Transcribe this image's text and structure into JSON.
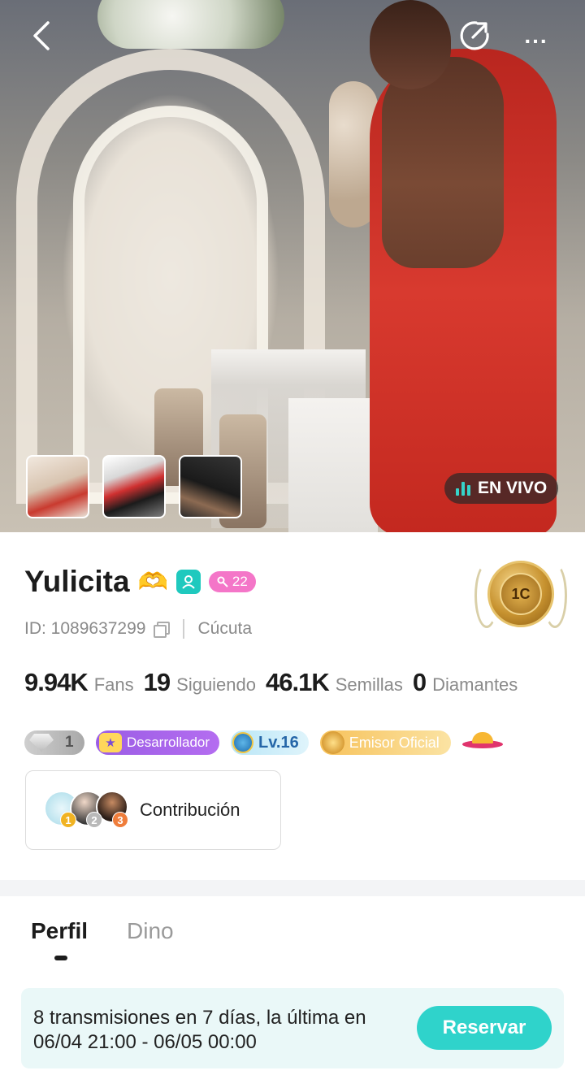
{
  "hero": {
    "live_label": "EN VIVO",
    "thumbnails": [
      "photo-1",
      "photo-2",
      "photo-3"
    ]
  },
  "header": {
    "back_icon": "chevron-left-icon",
    "share_icon": "share-icon",
    "more_label": "..."
  },
  "profile": {
    "name": "Yulicita",
    "name_emoji": "🫶",
    "level_badge": "22",
    "id_text": "ID: 1089637299",
    "city": "Cúcuta",
    "medal_text": "1C"
  },
  "stats": [
    {
      "value": "9.94K",
      "label": "Fans"
    },
    {
      "value": "19",
      "label": "Siguiendo"
    },
    {
      "value": "46.1K",
      "label": "Semillas"
    },
    {
      "value": "0",
      "label": "Diamantes"
    }
  ],
  "badges": {
    "diamond_count": "1",
    "developer": "Desarrollador",
    "level": "Lv.16",
    "official": "Emisor Oficial"
  },
  "contribution": {
    "label": "Contribución",
    "ranks": [
      "1",
      "2",
      "3"
    ]
  },
  "tabs": [
    {
      "label": "Perfil",
      "active": true
    },
    {
      "label": "Dino",
      "active": false
    }
  ],
  "schedule": {
    "text_line1": "8 transmisiones en 7 días, la última en",
    "text_line2": "06/04 21:00 - 06/05 00:00",
    "button": "Reservar"
  },
  "colors": {
    "accent": "#2fd3cb",
    "live_bars": "#36d3c9",
    "level_pill": "#f476c8",
    "developer_badge": "#9b5de5"
  }
}
